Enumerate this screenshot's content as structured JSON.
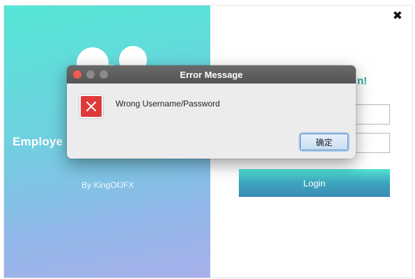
{
  "app": {
    "title": "Employe",
    "byline": "By KingOfJFX",
    "welcome_fragment": "n!",
    "close_glyph": "✖",
    "login_label": "Login",
    "username": {
      "value": "",
      "placeholder": ""
    },
    "password": {
      "value": "",
      "placeholder": ""
    }
  },
  "dialog": {
    "title": "Error Message",
    "message": "Wrong Username/Password",
    "ok_label": "确定",
    "icon": "error-x-icon"
  },
  "colors": {
    "gradient_top": "#55e6d6",
    "gradient_bottom": "#a8b0ea",
    "welcome_text": "#2aa79a",
    "error_red": "#dd3b3b",
    "traffic_close": "#ee5a52",
    "titlebar": "#5e5e5e"
  }
}
